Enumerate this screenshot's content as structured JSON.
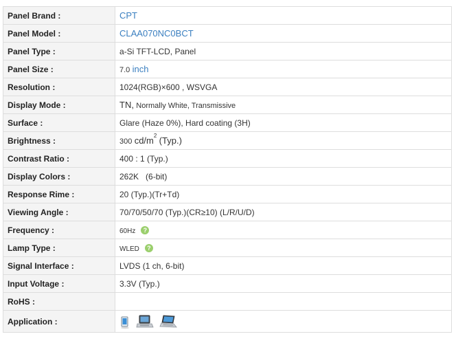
{
  "specs": [
    {
      "label": "Panel Brand :",
      "value": "CPT"
    },
    {
      "label": "Panel Model :",
      "value": "CLAA070NC0BCT"
    },
    {
      "label": "Panel Type :",
      "value": "a-Si TFT-LCD, Panel"
    },
    {
      "label": "Panel Size :",
      "value": "7.0",
      "unit": "inch"
    },
    {
      "label": "Resolution :",
      "value": "1024(RGB)×600 , WSVGA"
    },
    {
      "label": "Display Mode :",
      "value_main": "TN,",
      "value_rest": "Normally White, Transmissive"
    },
    {
      "label": "Surface :",
      "value": "Glare (Haze 0%), Hard coating (3H)"
    },
    {
      "label": "Brightness :",
      "value": "300",
      "unit": "cd/m",
      "unit_sup": "2",
      "suffix": "(Typ.)"
    },
    {
      "label": "Contrast Ratio :",
      "value": "400 : 1 (Typ.)"
    },
    {
      "label": "Display Colors :",
      "value": "262K   (6-bit)"
    },
    {
      "label": "Response Rime :",
      "value": "20 (Typ.)(Tr+Td)"
    },
    {
      "label": "Viewing Angle :",
      "value": "70/70/50/70 (Typ.)(CR≥10) (L/R/U/D)"
    },
    {
      "label": "Frequency :",
      "value": "60Hz",
      "help": "?"
    },
    {
      "label": "Lamp Type :",
      "value": "WLED",
      "help": "?"
    },
    {
      "label": "Signal Interface :",
      "value": "LVDS (1 ch, 6-bit)"
    },
    {
      "label": "Input Voltage :",
      "value": "3.3V (Typ.)"
    },
    {
      "label": "RoHS :",
      "value": ""
    },
    {
      "label": "Application :",
      "icons": [
        "tablet-icon",
        "netbook-icon",
        "laptop-icon"
      ]
    }
  ],
  "colors": {
    "link": "#3a7fc0",
    "label_bg": "#f4f4f4",
    "border": "#dddddd",
    "help_badge": "#9bcf6d"
  }
}
